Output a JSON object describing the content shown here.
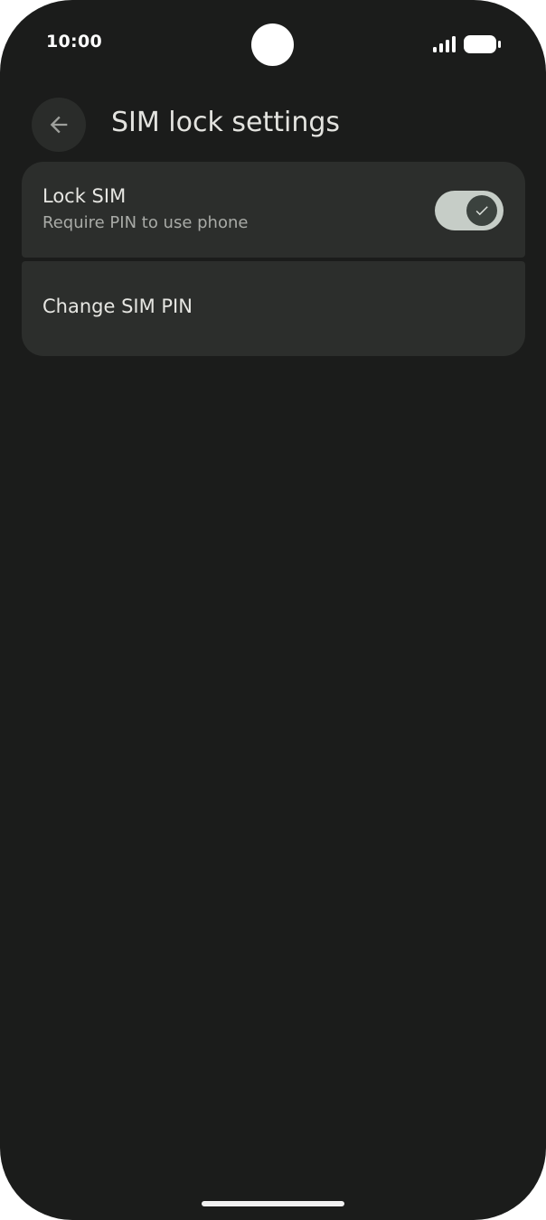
{
  "status_bar": {
    "time": "10:00",
    "icons": [
      "signal-icon",
      "battery-icon"
    ]
  },
  "app_bar": {
    "back_icon": "arrow-back-icon",
    "title": "SIM lock settings"
  },
  "settings": {
    "lock_sim": {
      "title": "Lock SIM",
      "summary": "Require PIN to use phone",
      "enabled": true
    },
    "change_pin": {
      "title": "Change SIM PIN"
    }
  },
  "colors": {
    "background": "#1b1c1b",
    "card": "#2c2e2c",
    "switch_track_on": "#c6cdc7",
    "switch_thumb_on": "#3b423e",
    "text_primary": "#e6e6e2",
    "text_secondary": "#a9aba7"
  }
}
